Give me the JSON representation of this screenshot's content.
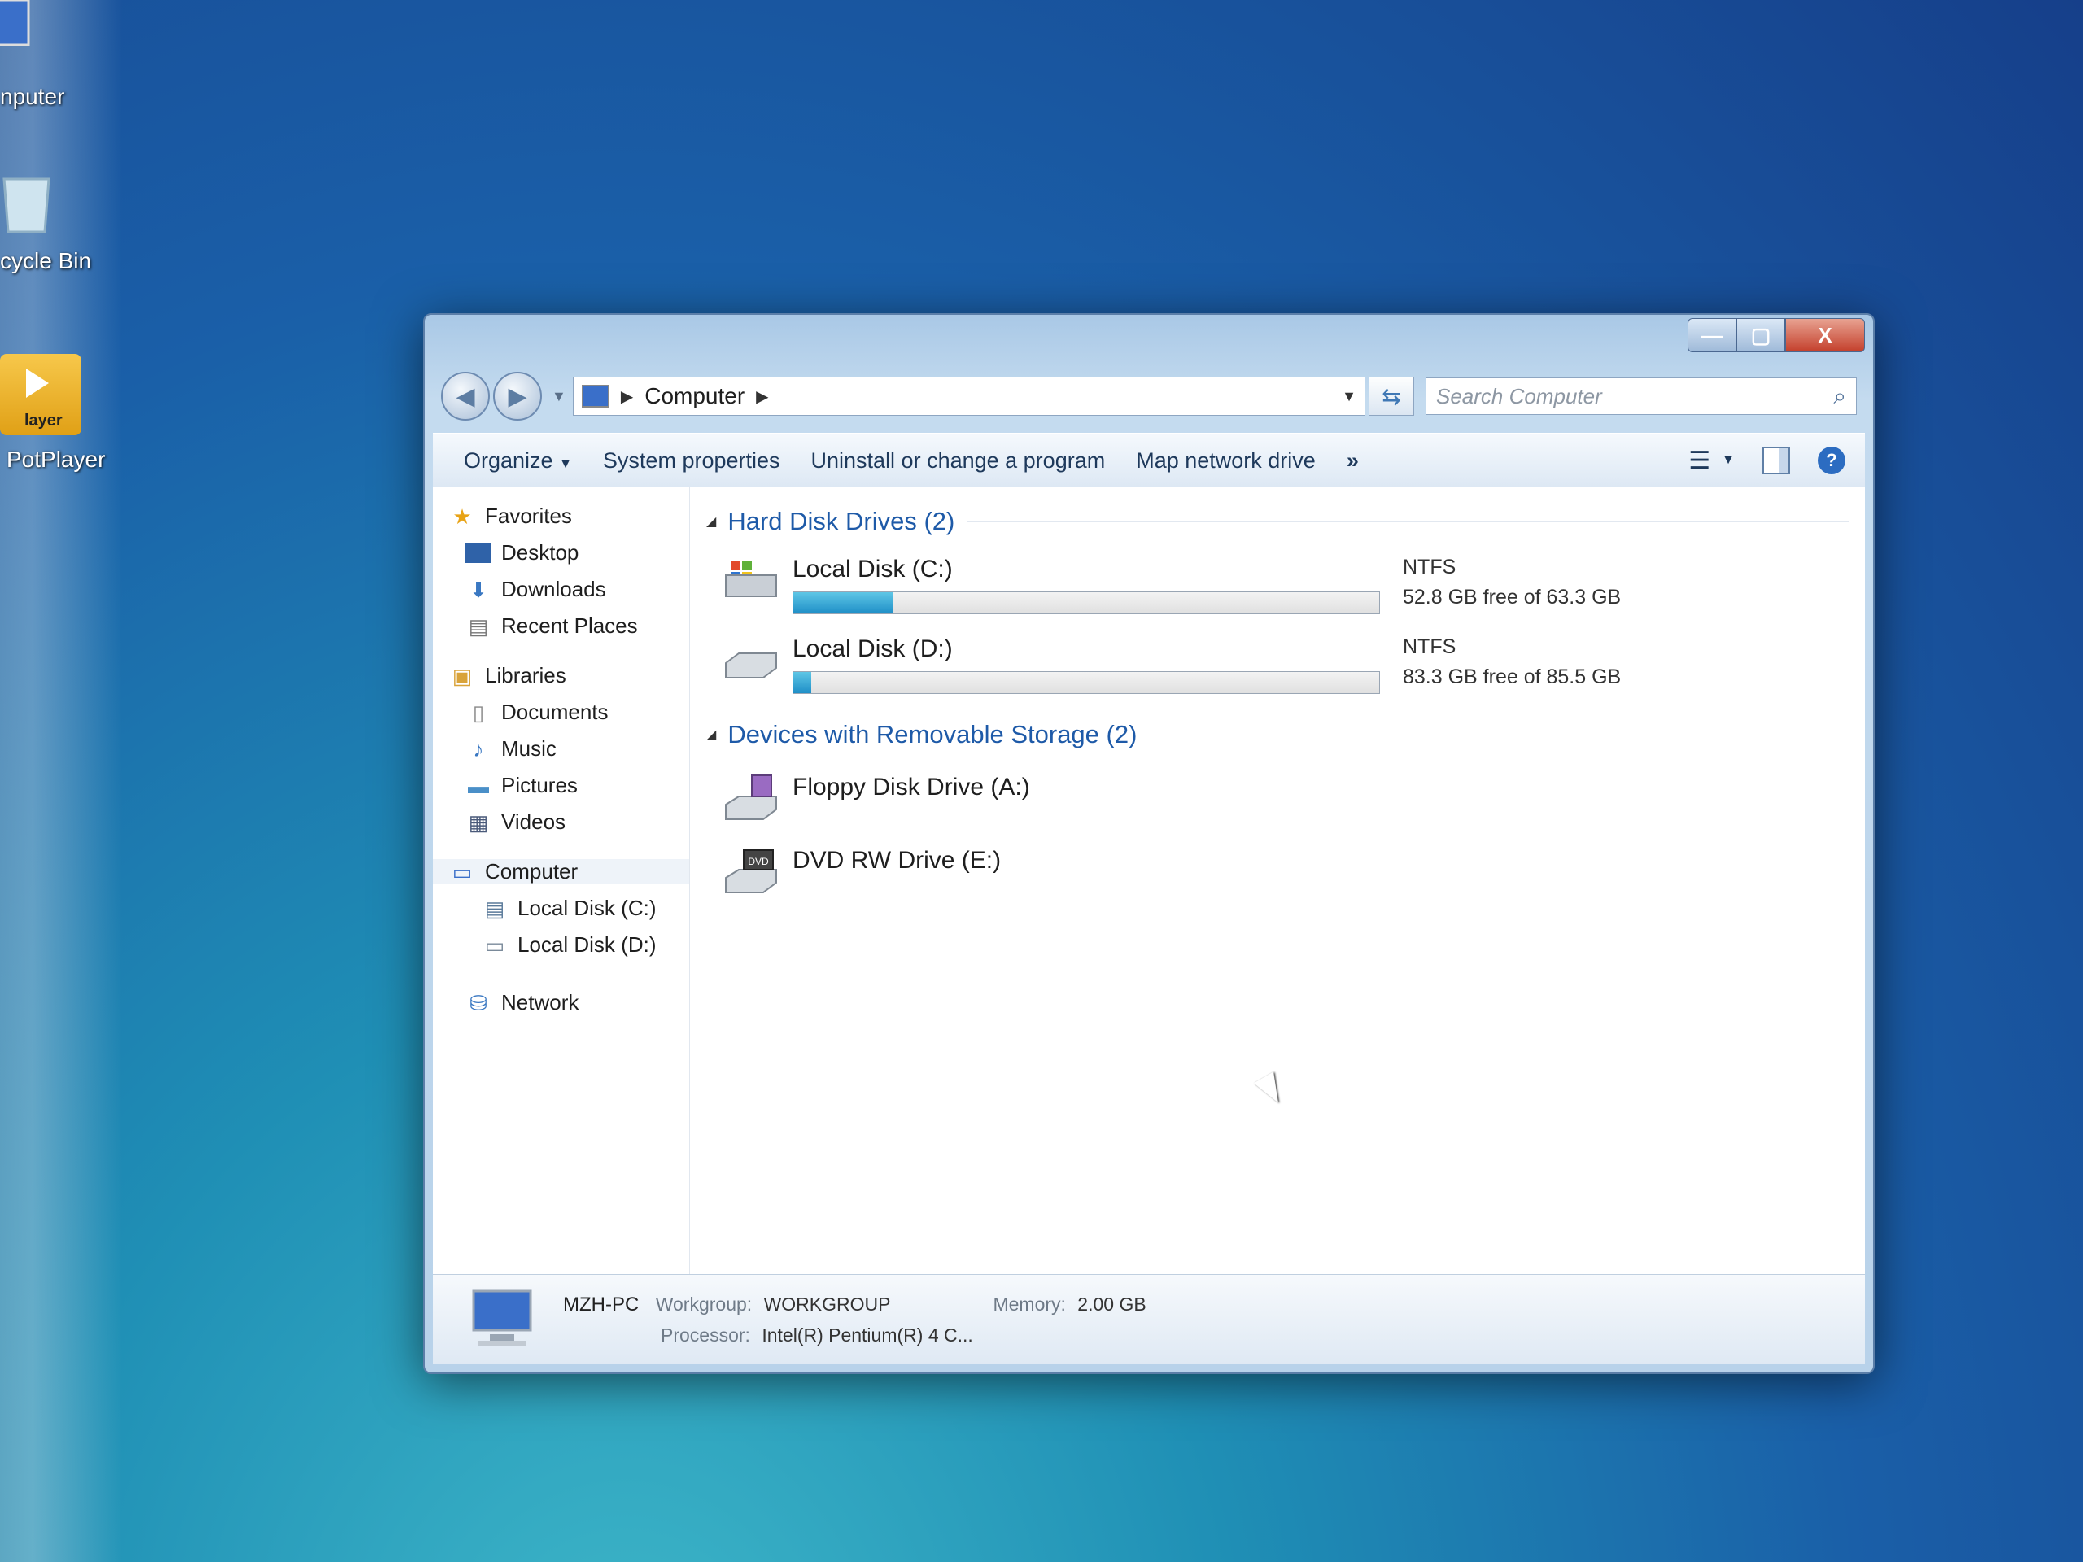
{
  "desktop": {
    "icons": [
      {
        "label": "nputer",
        "icon": "computer-icon"
      },
      {
        "label": "cycle Bin",
        "icon": "recycle-bin-icon"
      },
      {
        "label": "PotPlayer",
        "icon": "potplayer-icon",
        "badge": "layer"
      }
    ]
  },
  "window": {
    "caption_buttons": {
      "minimize": "—",
      "maximize": "▢",
      "close": "X"
    },
    "address": {
      "root_label": "Computer"
    },
    "search": {
      "placeholder": "Search Computer"
    },
    "toolbar": {
      "organize": "Organize",
      "system_properties": "System properties",
      "uninstall": "Uninstall or change a program",
      "map_drive": "Map network drive",
      "more": "»"
    },
    "nav": {
      "favorites": {
        "label": "Favorites",
        "items": [
          "Desktop",
          "Downloads",
          "Recent Places"
        ]
      },
      "libraries": {
        "label": "Libraries",
        "items": [
          "Documents",
          "Music",
          "Pictures",
          "Videos"
        ]
      },
      "computer": {
        "label": "Computer",
        "items": [
          "Local Disk (C:)",
          "Local Disk (D:)"
        ]
      },
      "network": {
        "label": "Network"
      }
    },
    "sections": {
      "hard_disks": {
        "label": "Hard Disk Drives (2)",
        "drives": [
          {
            "name": "Local Disk (C:)",
            "fs": "NTFS",
            "free": "52.8 GB free of 63.3 GB",
            "used_fraction": 0.17
          },
          {
            "name": "Local Disk (D:)",
            "fs": "NTFS",
            "free": "83.3 GB free of 85.5 GB",
            "used_fraction": 0.03
          }
        ]
      },
      "removable": {
        "label": "Devices with Removable Storage (2)",
        "devices": [
          {
            "name": "Floppy Disk Drive (A:)"
          },
          {
            "name": "DVD RW Drive (E:)",
            "badge": "DVD"
          }
        ]
      }
    },
    "details": {
      "pc_name": "MZH-PC",
      "workgroup_label": "Workgroup:",
      "workgroup": "WORKGROUP",
      "memory_label": "Memory:",
      "memory": "2.00 GB",
      "processor_label": "Processor:",
      "processor": "Intel(R) Pentium(R) 4 C..."
    }
  }
}
